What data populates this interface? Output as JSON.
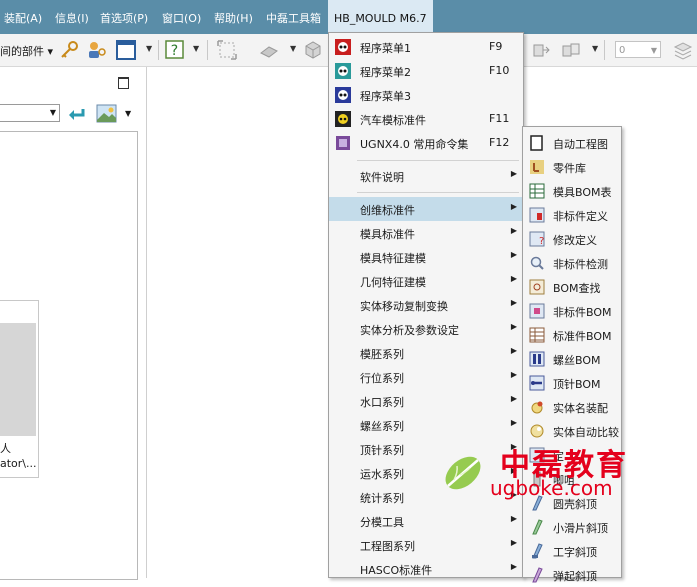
{
  "menubar": {
    "items": [
      {
        "label": "装配(A)"
      },
      {
        "label": "信息(I)"
      },
      {
        "label": "首选项(P)"
      },
      {
        "label": "窗口(O)"
      },
      {
        "label": "帮助(H)"
      },
      {
        "label": "中磊工具箱"
      },
      {
        "label": "HB_MOULD M6.7"
      }
    ]
  },
  "toolbar": {
    "left_text": "间的部件 ▾",
    "combo_value": "0"
  },
  "left_panel": {
    "thumb_line1": "人",
    "thumb_line2": "ator\\..."
  },
  "main_menu": {
    "items": [
      {
        "label": "程序菜单1",
        "shortcut": "F9",
        "icon": "program-menu-icon"
      },
      {
        "label": "程序菜单2",
        "shortcut": "F10",
        "icon": "program-menu-icon"
      },
      {
        "label": "程序菜单3",
        "shortcut": "",
        "icon": "program-menu-icon"
      },
      {
        "label": "汽车模标准件",
        "shortcut": "F11",
        "icon": "auto-mold-icon"
      },
      {
        "label": "UGNX4.0 常用命令集",
        "shortcut": "F12",
        "icon": "command-set-icon"
      },
      {
        "label": "软件说明",
        "submenu": true
      },
      {
        "label": "创维标准件",
        "submenu": true,
        "highlighted": true
      },
      {
        "label": "模具标准件",
        "submenu": true
      },
      {
        "label": "模具特征建模",
        "submenu": true
      },
      {
        "label": "几何特征建模",
        "submenu": true
      },
      {
        "label": "实体移动复制变换",
        "submenu": true
      },
      {
        "label": "实体分析及参数设定",
        "submenu": true
      },
      {
        "label": "模胚系列",
        "submenu": true
      },
      {
        "label": "行位系列",
        "submenu": true
      },
      {
        "label": "水口系列",
        "submenu": true
      },
      {
        "label": "螺丝系列",
        "submenu": true
      },
      {
        "label": "顶针系列",
        "submenu": true
      },
      {
        "label": "运水系列",
        "submenu": true
      },
      {
        "label": "统计系列",
        "submenu": true
      },
      {
        "label": "分模工具",
        "submenu": true
      },
      {
        "label": "工程图系列",
        "submenu": true
      },
      {
        "label": "HASCO标准件",
        "submenu": true
      }
    ]
  },
  "sub_menu": {
    "items": [
      {
        "label": "自动工程图",
        "icon": "drawing-icon"
      },
      {
        "label": "零件库",
        "icon": "parts-library-icon"
      },
      {
        "label": "模具BOM表",
        "icon": "bom-table-icon"
      },
      {
        "label": "非标件定义",
        "icon": "define-icon"
      },
      {
        "label": "修改定义",
        "icon": "edit-define-icon"
      },
      {
        "label": "非标件检测",
        "icon": "inspect-icon"
      },
      {
        "label": "BOM查找",
        "icon": "bom-find-icon"
      },
      {
        "label": "非标件BOM",
        "icon": "nonstd-bom-icon"
      },
      {
        "label": "标准件BOM",
        "icon": "std-bom-icon"
      },
      {
        "label": "螺丝BOM",
        "icon": "screw-bom-icon"
      },
      {
        "label": "顶针BOM",
        "icon": "pin-bom-icon"
      },
      {
        "label": "实体名装配",
        "icon": "assembly-icon"
      },
      {
        "label": "实体自动比较",
        "icon": "compare-icon"
      },
      {
        "label": "定...",
        "icon": "define2-icon"
      },
      {
        "label": "唧咀",
        "icon": "sprue-icon"
      },
      {
        "label": "圆壳斜顶",
        "icon": "lifter-icon"
      },
      {
        "label": "小滑片斜顶",
        "icon": "slider-lifter-icon"
      },
      {
        "label": "工字斜顶",
        "icon": "i-lifter-icon"
      },
      {
        "label": "弹起斜顶",
        "icon": "spring-lifter-icon"
      }
    ]
  },
  "watermark": {
    "cn": "中磊教育",
    "url": "ugboke.com"
  },
  "colors": {
    "menubar": "#5a8da8",
    "highlight": "#c4dcea",
    "watermark": "#e4001c"
  }
}
